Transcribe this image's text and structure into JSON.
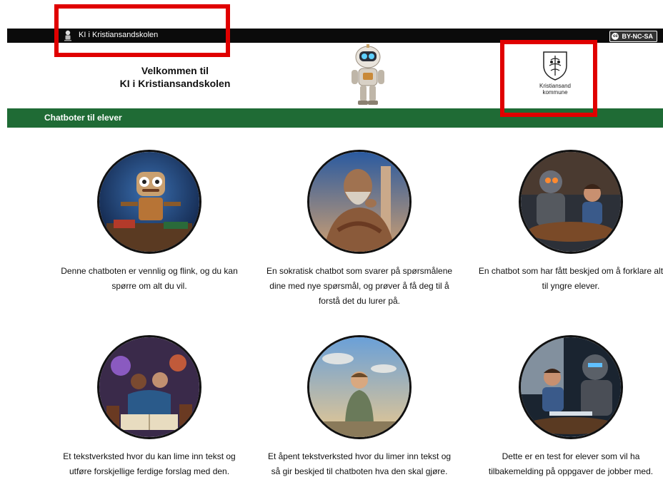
{
  "topbar": {
    "site_title": "KI i Kristiansandskolen",
    "license": "BY-NC-SA",
    "cc_mark": "cc"
  },
  "header": {
    "welcome_line1": "Velkommen til",
    "welcome_line2": "KI i Kristiansandskolen",
    "kommune_line1": "Kristiansand",
    "kommune_line2": "kommune"
  },
  "section": {
    "title": "Chatboter til elever"
  },
  "cards": [
    {
      "description": "Denne chatboten er vennlig og flink, og du kan spørre om alt du vil."
    },
    {
      "description": "En sokratisk chatbot som svarer på spørsmålene dine med nye spørsmål, og prøver å få deg til å forstå det du lurer på."
    },
    {
      "description": "En chatbot som har fått beskjed om å forklare alt til yngre elever."
    },
    {
      "description": "Et tekstverksted hvor du kan lime inn tekst og utføre forskjellige ferdige forslag med den."
    },
    {
      "description": "Et åpent tekstverksted hvor du limer inn tekst og så gir beskjed til chatboten hva den skal gjøre."
    },
    {
      "description": "Dette er en test for elever som vil ha tilbakemelding på oppgaver de jobber med."
    }
  ],
  "colors": {
    "topbar": "#0b0b0b",
    "section_bar": "#1f6b35",
    "highlight": "#e00000"
  },
  "icons": [
    "robot-mascot-icon",
    "kristiansand-coat-of-arms-icon",
    "creative-commons-icon"
  ]
}
